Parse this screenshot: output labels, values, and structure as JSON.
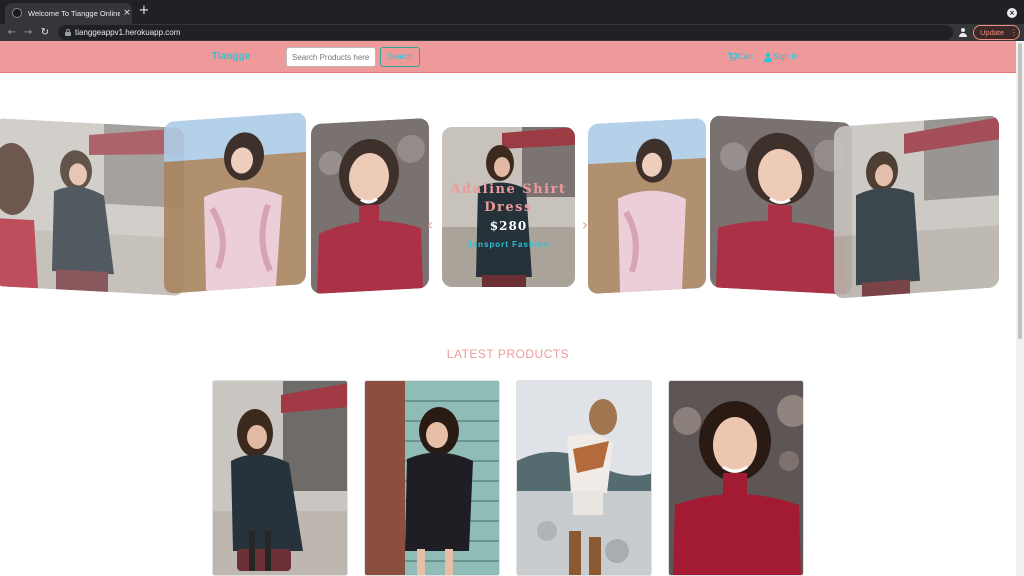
{
  "browser": {
    "tab_title": "Welcome To Tiangge Online Shop",
    "tab_close": "×",
    "new_tab": "+",
    "url": "tianggeappv1.herokuapp.com",
    "update_label": "Update",
    "icons": [
      "back-arrow-icon",
      "forward-arrow-icon",
      "reload-icon",
      "lock-icon",
      "star-icon",
      "profile-icon",
      "menu-dots-icon"
    ]
  },
  "site": {
    "brand": "Tiangge",
    "search_placeholder": "Search Products here",
    "search_button": "Search",
    "nav": {
      "cart": "Cart",
      "signin": "Sign In"
    },
    "accent_color": "#26c6da",
    "nav_bg_color": "#ef9a9a"
  },
  "carousel": {
    "active_slide": {
      "name": "Adaline Shirt Dress",
      "price": "$280",
      "brand": "Jansport Fashion"
    },
    "prev_arrow": "‹",
    "next_arrow": "›"
  },
  "latest": {
    "title": "LATEST PRODUCTS"
  }
}
